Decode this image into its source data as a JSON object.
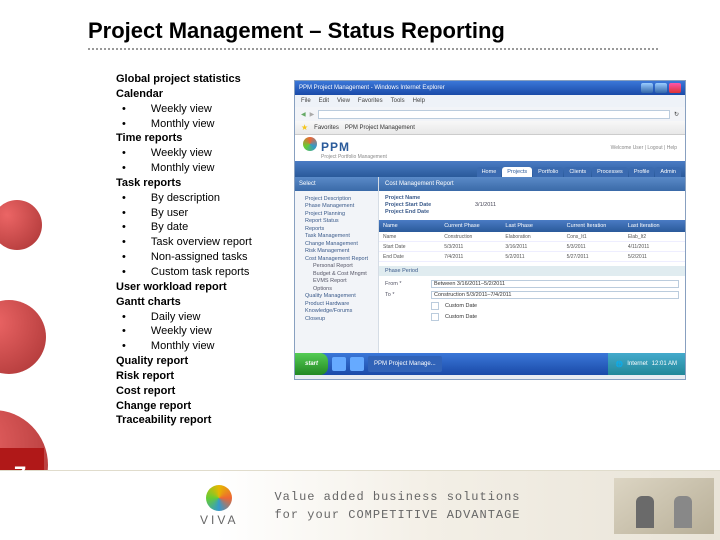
{
  "title": "Project Management – Status Reporting",
  "list": {
    "l0": "Global project statistics",
    "l1": "Calendar",
    "l1a": "Weekly view",
    "l1b": "Monthly view",
    "l2": "Time reports",
    "l2a": "Weekly view",
    "l2b": "Monthly view",
    "l3": "Task reports",
    "l3a": "By description",
    "l3b": "By user",
    "l3c": "By date",
    "l3d": "Task overview report",
    "l3e": "Non-assigned tasks",
    "l3f": "Custom task reports",
    "l4": "User workload report",
    "l5": "Gantt charts",
    "l5a": "Daily view",
    "l5b": "Weekly view",
    "l5c": "Monthly view",
    "l6": "Quality report",
    "l7": "Risk report",
    "l8": "Cost report",
    "l9": "Change report",
    "l10": "Traceability report"
  },
  "screenshot": {
    "window_title": "PPM Project Management - Windows Internet Explorer",
    "menu": {
      "m0": "File",
      "m1": "Edit",
      "m2": "View",
      "m3": "Favorites",
      "m4": "Tools",
      "m5": "Help"
    },
    "toolbar": {
      "fav": "Favorites",
      "tab_title": "PPM Project Management"
    },
    "brand": {
      "name": "PPM",
      "sub": "Project Portfolio Management",
      "welcome": "Welcome User | Logout | Help"
    },
    "tabs": {
      "t0": "Home",
      "t1": "Projects",
      "t2": "Portfolio",
      "t3": "Clients",
      "t4": "Processes",
      "t5": "Profile",
      "t6": "Admin"
    },
    "nav": {
      "hdr": "Select",
      "i0": "Project Description",
      "i1": "Phase Management",
      "i2": "Project Planning",
      "i3": "Report Status",
      "i4": "Reports",
      "i5": "Task Management",
      "i6": "Change Management",
      "i7": "Risk Management",
      "i8": "Cost Management Report",
      "i8a": "Personal Report",
      "i8b": "Budget & Cost Mngmt",
      "i8c": "EVMS Report",
      "i8d": "Options",
      "i9": "Quality Management",
      "i10": "Product Hardware",
      "i11": "Knowledge/Forums",
      "i12": "Closeup"
    },
    "pane": {
      "hdr": "Cost Management Report",
      "meta": {
        "k0": "Project Name",
        "k1": "Project Start Date",
        "v1": "3/1/2011",
        "k2": "Project End Date"
      },
      "cols": {
        "c0": "Name",
        "c1": "Current Phase",
        "c2": "Last Phase",
        "c3": "Current Iteration",
        "c4": "Last Iteration"
      },
      "rows": {
        "r0": {
          "c0": "Name",
          "c1": "Construction",
          "c2": "Elaboration",
          "c3": "Cons_It1",
          "c4": "Elab_It2"
        },
        "r1": {
          "c0": "Start Date",
          "c1": "5/3/2011",
          "c2": "3/16/2011",
          "c3": "5/3/2011",
          "c4": "4/11/2011"
        },
        "r2": {
          "c0": "End Date",
          "c1": "7/4/2011",
          "c2": "5/2/2011",
          "c3": "5/27/2011",
          "c4": "5/2/2011"
        }
      },
      "sec": "Phase Period",
      "form": {
        "f0": "From *",
        "f1": "To *",
        "v0": "Between 3/16/2011–5/2/2011",
        "v1": "Construction 5/3/2011–7/4/2011",
        "c0": "Custom Date",
        "c1": "Custom Date"
      }
    },
    "taskbar": {
      "start": "start",
      "item": "PPM Project Manage...",
      "tray_net": "Internet",
      "tray_time": "12:01 AM"
    }
  },
  "footer": {
    "logo": "VIVA",
    "line1": "Value added business solutions",
    "line2": "for your COMPETITIVE ADVANTAGE"
  },
  "page": "7"
}
